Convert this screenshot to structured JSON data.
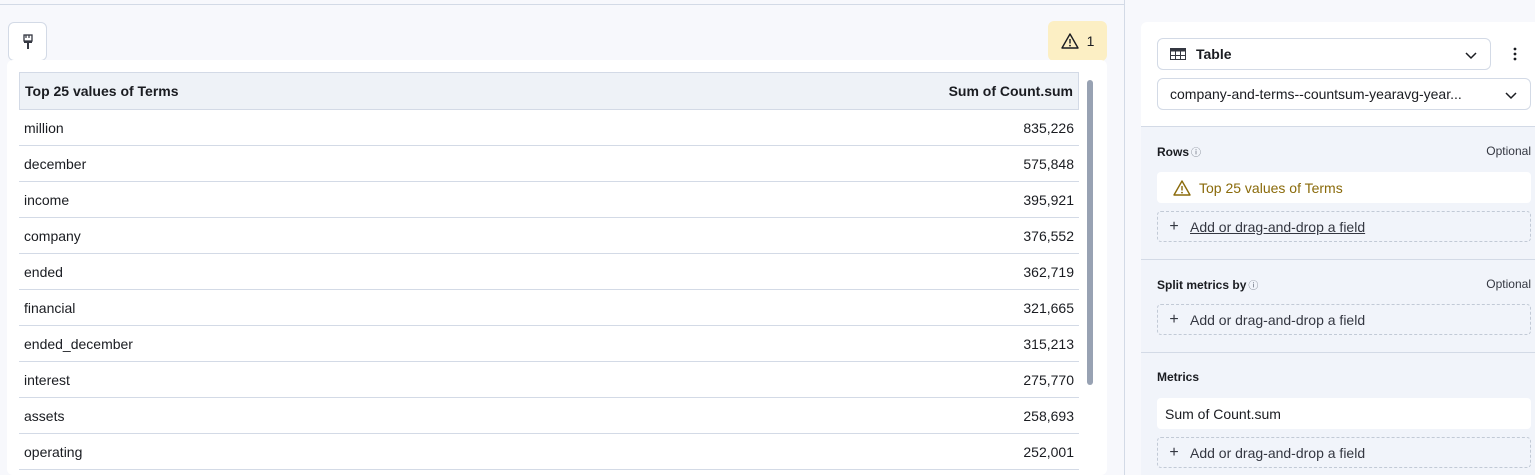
{
  "toolbar": {
    "paint_icon": "paintbrush-icon",
    "warning_count": "1"
  },
  "table": {
    "columns": [
      "Top 25 values of Terms",
      "Sum of Count.sum"
    ],
    "rows": [
      [
        "million",
        "835,226"
      ],
      [
        "december",
        "575,848"
      ],
      [
        "income",
        "395,921"
      ],
      [
        "company",
        "376,552"
      ],
      [
        "ended",
        "362,719"
      ],
      [
        "financial",
        "321,665"
      ],
      [
        "ended_december",
        "315,213"
      ],
      [
        "interest",
        "275,770"
      ],
      [
        "assets",
        "258,693"
      ],
      [
        "operating",
        "252,001"
      ]
    ]
  },
  "panel": {
    "chart_type": "Table",
    "dataset": "company-and-terms--countsum-yearavg-year...",
    "rows_section": {
      "title": "Rows",
      "optional": "Optional",
      "field": "Top 25 values of Terms",
      "add_label": "Add or drag-and-drop a field"
    },
    "split_section": {
      "title": "Split metrics by",
      "optional": "Optional",
      "add_label": "Add or drag-and-drop a field"
    },
    "metrics_section": {
      "title": "Metrics",
      "field": "Sum of Count.sum",
      "add_label": "Add or drag-and-drop a field"
    }
  },
  "colors": {
    "warning_bg": "#fcefc4",
    "warning_text": "#8a6a0a",
    "header_bg": "#eef2f7",
    "border": "#d3dae6"
  }
}
